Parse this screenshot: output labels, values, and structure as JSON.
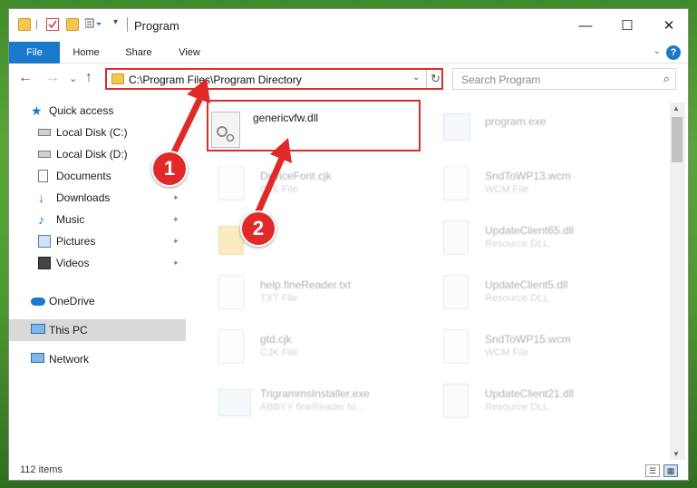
{
  "window": {
    "title": "Program",
    "minimize_glyph": "—",
    "maximize_glyph": "☐",
    "close_glyph": "✕"
  },
  "ribbon": {
    "tabs": [
      "File",
      "Home",
      "Share",
      "View"
    ],
    "help_glyph": "?",
    "expand_glyph": "⌄"
  },
  "navbar": {
    "back_glyph": "←",
    "forward_glyph": "→",
    "recent_glyph": "⌄",
    "up_glyph": "↑",
    "address_value": "C:\\Program Files\\Program Directory",
    "address_dropdown_glyph": "⌄",
    "refresh_glyph": "↻",
    "search_placeholder": "Search Program",
    "search_glyph": "⌕"
  },
  "sidebar": {
    "items": [
      {
        "label": "Quick access",
        "icon": "star-icon"
      },
      {
        "label": "Local Disk (C:)",
        "icon": "drive-icon"
      },
      {
        "label": "Local Disk (D:)",
        "icon": "drive-icon"
      },
      {
        "label": "Documents",
        "icon": "documents-icon"
      },
      {
        "label": "Downloads",
        "icon": "download-icon",
        "pinned": true
      },
      {
        "label": "Music",
        "icon": "music-icon",
        "pinned": true
      },
      {
        "label": "Pictures",
        "icon": "pictures-icon",
        "pinned": true
      },
      {
        "label": "Videos",
        "icon": "video-icon",
        "pinned": true
      },
      {
        "label": "OneDrive",
        "icon": "cloud-icon"
      },
      {
        "label": "This PC",
        "icon": "computer-icon",
        "selected": true
      },
      {
        "label": "Network",
        "icon": "network-icon"
      }
    ],
    "pin_glyph": "📌"
  },
  "files": {
    "selected": {
      "name": "genericvfw.dll",
      "type": ""
    },
    "col1": [
      {
        "name": "DeviceFont.cjk",
        "type": "CJK File"
      },
      {
        "name": "",
        "type": ""
      },
      {
        "name": "help.fineReader.txt",
        "type": "TXT File"
      },
      {
        "name": "gtd.cjk",
        "type": "CJK File"
      },
      {
        "name": "TrigrammsInstaller.exe",
        "type": "ABBYY fineReader to..."
      }
    ],
    "col2": [
      {
        "name": "program.exe",
        "type": ""
      },
      {
        "name": "SndToWP13.wcm",
        "type": "WCM File"
      },
      {
        "name": "UpdateClient65.dll",
        "type": "Resource DLL"
      },
      {
        "name": "UpdateClient5.dll",
        "type": "Resource DLL"
      },
      {
        "name": "SndToWP15.wcm",
        "type": "WCM File"
      },
      {
        "name": "UpdateClient21.dll",
        "type": "Resource DLL"
      }
    ]
  },
  "markers": {
    "step1": "1",
    "step2": "2"
  },
  "status": {
    "item_count": "112 items"
  },
  "colors": {
    "accent": "#1979ca",
    "highlight_red": "#e02a2a",
    "folder": "#f4c84f"
  }
}
